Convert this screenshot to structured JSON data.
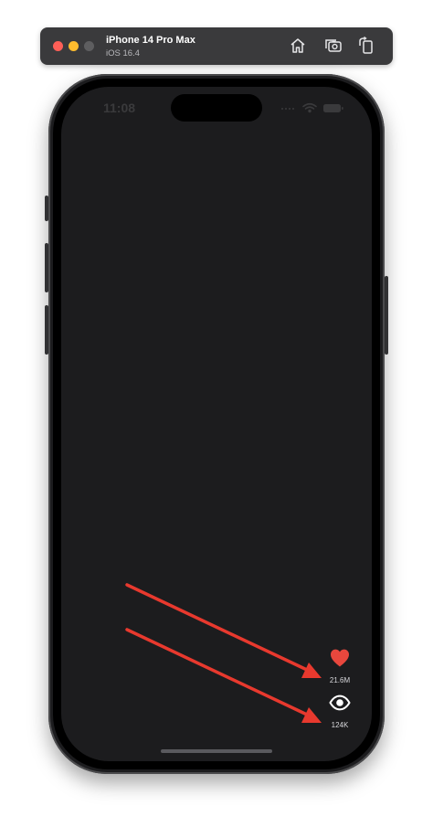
{
  "simulator": {
    "device_name": "iPhone 14 Pro Max",
    "os_version": "iOS 16.4",
    "icons": [
      "home-icon",
      "screenshot-icon",
      "rotate-icon"
    ]
  },
  "status_bar": {
    "time": "11:08"
  },
  "stats": {
    "likes": {
      "icon": "heart-icon",
      "count": "21.6M",
      "color": "#e8473d"
    },
    "views": {
      "icon": "eye-icon",
      "count": "124K"
    }
  },
  "colors": {
    "screen_bg": "#1c1c1e",
    "annotation_arrow": "#e8392e",
    "title_bar": "#3a3a3c"
  }
}
